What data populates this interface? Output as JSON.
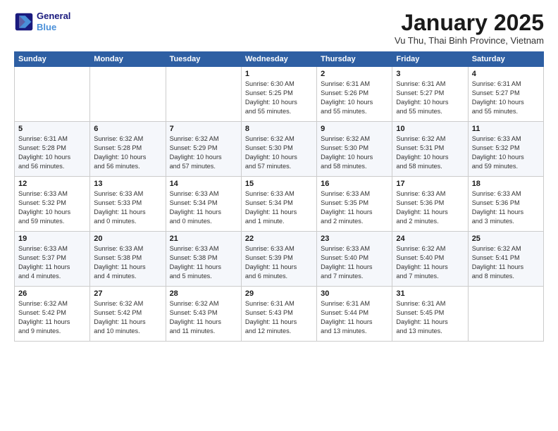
{
  "logo": {
    "line1": "General",
    "line2": "Blue"
  },
  "title": "January 2025",
  "subtitle": "Vu Thu, Thai Binh Province, Vietnam",
  "days_header": [
    "Sunday",
    "Monday",
    "Tuesday",
    "Wednesday",
    "Thursday",
    "Friday",
    "Saturday"
  ],
  "weeks": [
    [
      {
        "num": "",
        "info": ""
      },
      {
        "num": "",
        "info": ""
      },
      {
        "num": "",
        "info": ""
      },
      {
        "num": "1",
        "info": "Sunrise: 6:30 AM\nSunset: 5:25 PM\nDaylight: 10 hours\nand 55 minutes."
      },
      {
        "num": "2",
        "info": "Sunrise: 6:31 AM\nSunset: 5:26 PM\nDaylight: 10 hours\nand 55 minutes."
      },
      {
        "num": "3",
        "info": "Sunrise: 6:31 AM\nSunset: 5:27 PM\nDaylight: 10 hours\nand 55 minutes."
      },
      {
        "num": "4",
        "info": "Sunrise: 6:31 AM\nSunset: 5:27 PM\nDaylight: 10 hours\nand 55 minutes."
      }
    ],
    [
      {
        "num": "5",
        "info": "Sunrise: 6:31 AM\nSunset: 5:28 PM\nDaylight: 10 hours\nand 56 minutes."
      },
      {
        "num": "6",
        "info": "Sunrise: 6:32 AM\nSunset: 5:28 PM\nDaylight: 10 hours\nand 56 minutes."
      },
      {
        "num": "7",
        "info": "Sunrise: 6:32 AM\nSunset: 5:29 PM\nDaylight: 10 hours\nand 57 minutes."
      },
      {
        "num": "8",
        "info": "Sunrise: 6:32 AM\nSunset: 5:30 PM\nDaylight: 10 hours\nand 57 minutes."
      },
      {
        "num": "9",
        "info": "Sunrise: 6:32 AM\nSunset: 5:30 PM\nDaylight: 10 hours\nand 58 minutes."
      },
      {
        "num": "10",
        "info": "Sunrise: 6:32 AM\nSunset: 5:31 PM\nDaylight: 10 hours\nand 58 minutes."
      },
      {
        "num": "11",
        "info": "Sunrise: 6:33 AM\nSunset: 5:32 PM\nDaylight: 10 hours\nand 59 minutes."
      }
    ],
    [
      {
        "num": "12",
        "info": "Sunrise: 6:33 AM\nSunset: 5:32 PM\nDaylight: 10 hours\nand 59 minutes."
      },
      {
        "num": "13",
        "info": "Sunrise: 6:33 AM\nSunset: 5:33 PM\nDaylight: 11 hours\nand 0 minutes."
      },
      {
        "num": "14",
        "info": "Sunrise: 6:33 AM\nSunset: 5:34 PM\nDaylight: 11 hours\nand 0 minutes."
      },
      {
        "num": "15",
        "info": "Sunrise: 6:33 AM\nSunset: 5:34 PM\nDaylight: 11 hours\nand 1 minute."
      },
      {
        "num": "16",
        "info": "Sunrise: 6:33 AM\nSunset: 5:35 PM\nDaylight: 11 hours\nand 2 minutes."
      },
      {
        "num": "17",
        "info": "Sunrise: 6:33 AM\nSunset: 5:36 PM\nDaylight: 11 hours\nand 2 minutes."
      },
      {
        "num": "18",
        "info": "Sunrise: 6:33 AM\nSunset: 5:36 PM\nDaylight: 11 hours\nand 3 minutes."
      }
    ],
    [
      {
        "num": "19",
        "info": "Sunrise: 6:33 AM\nSunset: 5:37 PM\nDaylight: 11 hours\nand 4 minutes."
      },
      {
        "num": "20",
        "info": "Sunrise: 6:33 AM\nSunset: 5:38 PM\nDaylight: 11 hours\nand 4 minutes."
      },
      {
        "num": "21",
        "info": "Sunrise: 6:33 AM\nSunset: 5:38 PM\nDaylight: 11 hours\nand 5 minutes."
      },
      {
        "num": "22",
        "info": "Sunrise: 6:33 AM\nSunset: 5:39 PM\nDaylight: 11 hours\nand 6 minutes."
      },
      {
        "num": "23",
        "info": "Sunrise: 6:33 AM\nSunset: 5:40 PM\nDaylight: 11 hours\nand 7 minutes."
      },
      {
        "num": "24",
        "info": "Sunrise: 6:32 AM\nSunset: 5:40 PM\nDaylight: 11 hours\nand 7 minutes."
      },
      {
        "num": "25",
        "info": "Sunrise: 6:32 AM\nSunset: 5:41 PM\nDaylight: 11 hours\nand 8 minutes."
      }
    ],
    [
      {
        "num": "26",
        "info": "Sunrise: 6:32 AM\nSunset: 5:42 PM\nDaylight: 11 hours\nand 9 minutes."
      },
      {
        "num": "27",
        "info": "Sunrise: 6:32 AM\nSunset: 5:42 PM\nDaylight: 11 hours\nand 10 minutes."
      },
      {
        "num": "28",
        "info": "Sunrise: 6:32 AM\nSunset: 5:43 PM\nDaylight: 11 hours\nand 11 minutes."
      },
      {
        "num": "29",
        "info": "Sunrise: 6:31 AM\nSunset: 5:43 PM\nDaylight: 11 hours\nand 12 minutes."
      },
      {
        "num": "30",
        "info": "Sunrise: 6:31 AM\nSunset: 5:44 PM\nDaylight: 11 hours\nand 13 minutes."
      },
      {
        "num": "31",
        "info": "Sunrise: 6:31 AM\nSunset: 5:45 PM\nDaylight: 11 hours\nand 13 minutes."
      },
      {
        "num": "",
        "info": ""
      }
    ]
  ]
}
